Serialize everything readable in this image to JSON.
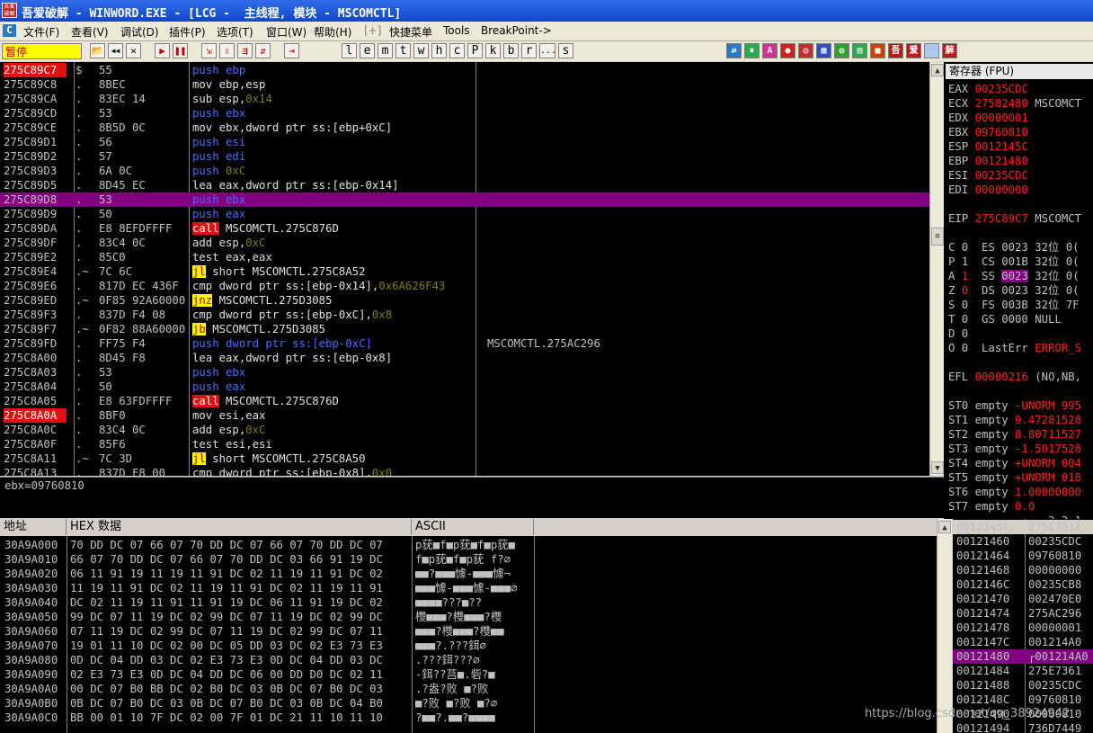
{
  "window": {
    "title": "吾爱破解 - WINWORD.EXE - [LCG -  主线程, 模块 - MSCOMCTL]",
    "icon_text": "吾爱破解"
  },
  "menu": [
    "文件(F)",
    "查看(V)",
    "调试(D)",
    "插件(P)",
    "选项(T)",
    "窗口(W)",
    "帮助(H)",
    "[+]",
    "快捷菜单",
    "Tools",
    "BreakPoint->"
  ],
  "toolbar": {
    "state": "暂停",
    "left_buttons": [
      "open-icon",
      "rewind-icon",
      "close-icon",
      "run-icon",
      "pause-icon",
      "step-into-icon",
      "step-over-icon",
      "trace-into-icon",
      "trace-over-icon",
      "execute-till-return-icon"
    ],
    "letters": [
      "l",
      "e",
      "m",
      "t",
      "w",
      "h",
      "c",
      "P",
      "k",
      "b",
      "r",
      "...",
      "s"
    ],
    "right_buttons": [
      "吾",
      "爱",
      "破",
      "解"
    ]
  },
  "disasm": {
    "selected_index": 9,
    "rows": [
      {
        "addr": "275C89C7",
        "addr_hl": true,
        "mark": "$",
        "hex": "55",
        "ins": [
          {
            "t": "push",
            "c": "blue"
          },
          {
            "t": " ebp",
            "c": "blue"
          }
        ],
        "cmt": ""
      },
      {
        "addr": "275C89C8",
        "mark": ".",
        "hex": "8BEC",
        "ins": [
          {
            "t": "mov ebp,esp",
            "c": "white"
          }
        ],
        "cmt": ""
      },
      {
        "addr": "275C89CA",
        "mark": ".",
        "hex": "83EC 14",
        "ins": [
          {
            "t": "sub esp,",
            "c": "white"
          },
          {
            "t": "0x14",
            "c": "num"
          }
        ],
        "cmt": ""
      },
      {
        "addr": "275C89CD",
        "mark": ".",
        "hex": "53",
        "ins": [
          {
            "t": "push ebx",
            "c": "blue"
          }
        ],
        "cmt": ""
      },
      {
        "addr": "275C89CE",
        "mark": ".",
        "hex": "8B5D 0C",
        "ins": [
          {
            "t": "mov ebx,dword ptr ss:[ebp+0xC]",
            "c": "white"
          }
        ],
        "cmt": ""
      },
      {
        "addr": "275C89D1",
        "mark": ".",
        "hex": "56",
        "ins": [
          {
            "t": "push esi",
            "c": "blue"
          }
        ],
        "cmt": ""
      },
      {
        "addr": "275C89D2",
        "mark": ".",
        "hex": "57",
        "ins": [
          {
            "t": "push edi",
            "c": "blue"
          }
        ],
        "cmt": ""
      },
      {
        "addr": "275C89D3",
        "mark": ".",
        "hex": "6A 0C",
        "ins": [
          {
            "t": "push ",
            "c": "blue"
          },
          {
            "t": "0xC",
            "c": "num"
          }
        ],
        "cmt": ""
      },
      {
        "addr": "275C89D5",
        "mark": ".",
        "hex": "8D45 EC",
        "ins": [
          {
            "t": "lea eax,dword ptr ss:[ebp-0x14]",
            "c": "white"
          }
        ],
        "cmt": ""
      },
      {
        "addr": "275C89D8",
        "mark": ".",
        "hex": "53",
        "ins": [
          {
            "t": "push ebx",
            "c": "blue"
          }
        ],
        "cmt": ""
      },
      {
        "addr": "275C89D9",
        "mark": ".",
        "hex": "50",
        "ins": [
          {
            "t": "push eax",
            "c": "blue"
          }
        ],
        "cmt": ""
      },
      {
        "addr": "275C89DA",
        "mark": ".",
        "hex": "E8 8EFDFFFF",
        "ins": [
          {
            "t": "call",
            "c": "hl"
          },
          {
            "t": " MSCOMCTL.275C876D",
            "c": "white"
          }
        ],
        "cmt": ""
      },
      {
        "addr": "275C89DF",
        "mark": ".",
        "hex": "83C4 0C",
        "ins": [
          {
            "t": "add esp,",
            "c": "white"
          },
          {
            "t": "0xC",
            "c": "num"
          }
        ],
        "cmt": ""
      },
      {
        "addr": "275C89E2",
        "mark": ".",
        "hex": "85C0",
        "ins": [
          {
            "t": "test eax,eax",
            "c": "white"
          }
        ],
        "cmt": ""
      },
      {
        "addr": "275C89E4",
        "mark": ".~",
        "hex": "7C 6C",
        "ins": [
          {
            "t": "jl",
            "c": "jcc"
          },
          {
            "t": " short MSCOMCTL.275C8A52",
            "c": "white"
          }
        ],
        "cmt": ""
      },
      {
        "addr": "275C89E6",
        "mark": ".",
        "hex": "817D EC 436F",
        "ins": [
          {
            "t": "cmp dword ptr ss:[ebp-0x14],",
            "c": "white"
          },
          {
            "t": "0x6A626F43",
            "c": "num"
          }
        ],
        "cmt": ""
      },
      {
        "addr": "275C89ED",
        "mark": ".~",
        "hex": "0F85 92A60000",
        "ins": [
          {
            "t": "jnz",
            "c": "jcc"
          },
          {
            "t": " MSCOMCTL.275D3085",
            "c": "white"
          }
        ],
        "cmt": ""
      },
      {
        "addr": "275C89F3",
        "mark": ".",
        "hex": "837D F4 08",
        "ins": [
          {
            "t": "cmp dword ptr ss:[ebp-0xC],",
            "c": "white"
          },
          {
            "t": "0x8",
            "c": "num"
          }
        ],
        "cmt": ""
      },
      {
        "addr": "275C89F7",
        "mark": ".~",
        "hex": "0F82 88A60000",
        "ins": [
          {
            "t": "jb",
            "c": "jcc"
          },
          {
            "t": " MSCOMCTL.275D3085",
            "c": "white"
          }
        ],
        "cmt": ""
      },
      {
        "addr": "275C89FD",
        "mark": ".",
        "hex": "FF75 F4",
        "ins": [
          {
            "t": "push dword ptr ss:[ebp-0xC]",
            "c": "blue"
          }
        ],
        "cmt": "MSCOMCTL.275AC296"
      },
      {
        "addr": "275C8A00",
        "mark": ".",
        "hex": "8D45 F8",
        "ins": [
          {
            "t": "lea eax,dword ptr ss:[ebp-0x8]",
            "c": "white"
          }
        ],
        "cmt": ""
      },
      {
        "addr": "275C8A03",
        "mark": ".",
        "hex": "53",
        "ins": [
          {
            "t": "push ebx",
            "c": "blue"
          }
        ],
        "cmt": ""
      },
      {
        "addr": "275C8A04",
        "mark": ".",
        "hex": "50",
        "ins": [
          {
            "t": "push eax",
            "c": "blue"
          }
        ],
        "cmt": ""
      },
      {
        "addr": "275C8A05",
        "mark": ".",
        "hex": "E8 63FDFFFF",
        "ins": [
          {
            "t": "call",
            "c": "hl"
          },
          {
            "t": " MSCOMCTL.275C876D",
            "c": "white"
          }
        ],
        "cmt": ""
      },
      {
        "addr": "275C8A0A",
        "addr_hl": true,
        "mark": ".",
        "hex": "8BF0",
        "ins": [
          {
            "t": "mov esi,eax",
            "c": "white"
          }
        ],
        "cmt": ""
      },
      {
        "addr": "275C8A0C",
        "mark": ".",
        "hex": "83C4 0C",
        "ins": [
          {
            "t": "add esp,",
            "c": "white"
          },
          {
            "t": "0xC",
            "c": "num"
          }
        ],
        "cmt": ""
      },
      {
        "addr": "275C8A0F",
        "mark": ".",
        "hex": "85F6",
        "ins": [
          {
            "t": "test esi,esi",
            "c": "white"
          }
        ],
        "cmt": ""
      },
      {
        "addr": "275C8A11",
        "mark": ".~",
        "hex": "7C 3D",
        "ins": [
          {
            "t": "jl",
            "c": "jcc"
          },
          {
            "t": " short MSCOMCTL.275C8A50",
            "c": "white"
          }
        ],
        "cmt": ""
      },
      {
        "addr": "275C8A13",
        "mark": ".",
        "hex": "837D F8 00",
        "ins": [
          {
            "t": "cmp dword ptr ss:[ebp-0x8],",
            "c": "white"
          },
          {
            "t": "0x0",
            "c": "num"
          }
        ],
        "cmt": ""
      }
    ]
  },
  "info": "ebx=09760810",
  "registers": {
    "header": "寄存器 (FPU)",
    "rows": [
      [
        {
          "t": "EAX "
        },
        {
          "t": "00235CDC",
          "c": "red"
        }
      ],
      [
        {
          "t": "ECX "
        },
        {
          "t": "27582480",
          "c": "red"
        },
        {
          "t": " MSCOMCT"
        }
      ],
      [
        {
          "t": "EDX "
        },
        {
          "t": "00000001",
          "c": "red"
        }
      ],
      [
        {
          "t": "EBX "
        },
        {
          "t": "09760810",
          "c": "red"
        }
      ],
      [
        {
          "t": "ESP "
        },
        {
          "t": "0012145C",
          "c": "red"
        }
      ],
      [
        {
          "t": "EBP "
        },
        {
          "t": "00121480",
          "c": "red"
        }
      ],
      [
        {
          "t": "ESI "
        },
        {
          "t": "00235CDC",
          "c": "red"
        }
      ],
      [
        {
          "t": "EDI "
        },
        {
          "t": "00000000",
          "c": "red"
        }
      ],
      [
        {
          "t": ""
        }
      ],
      [
        {
          "t": "EIP "
        },
        {
          "t": "275C89C7",
          "c": "red"
        },
        {
          "t": " MSCOMCT"
        }
      ],
      [
        {
          "t": ""
        }
      ],
      [
        {
          "t": "C 0  ES 0023 32位 0("
        }
      ],
      [
        {
          "t": "P 1  CS 001B 32位 0("
        }
      ],
      [
        {
          "t": "A "
        },
        {
          "t": "1",
          "c": "red"
        },
        {
          "t": "  SS "
        },
        {
          "t": "0023",
          "c": "mag"
        },
        {
          "t": " 32位 0("
        }
      ],
      [
        {
          "t": "Z "
        },
        {
          "t": "0",
          "c": "red"
        },
        {
          "t": "  DS 0023 32位 0("
        }
      ],
      [
        {
          "t": "S 0  FS 003B 32位 7F"
        }
      ],
      [
        {
          "t": "T 0  GS 0000 NULL"
        }
      ],
      [
        {
          "t": "D 0"
        }
      ],
      [
        {
          "t": "O 0  LastErr "
        },
        {
          "t": "ERROR_S",
          "c": "red"
        }
      ],
      [
        {
          "t": ""
        }
      ],
      [
        {
          "t": "EFL "
        },
        {
          "t": "00000216",
          "c": "red"
        },
        {
          "t": " (NO,NB,"
        }
      ],
      [
        {
          "t": ""
        }
      ],
      [
        {
          "t": "ST0 empty "
        },
        {
          "t": "-UNORM 995",
          "c": "red"
        }
      ],
      [
        {
          "t": "ST1 empty "
        },
        {
          "t": "9.47281528",
          "c": "red"
        }
      ],
      [
        {
          "t": "ST2 empty "
        },
        {
          "t": "8.80711527",
          "c": "red"
        }
      ],
      [
        {
          "t": "ST3 empty "
        },
        {
          "t": "-1.5017528",
          "c": "red"
        }
      ],
      [
        {
          "t": "ST4 empty "
        },
        {
          "t": "+UNORM 004",
          "c": "red"
        }
      ],
      [
        {
          "t": "ST5 empty "
        },
        {
          "t": "+UNORM 018",
          "c": "red"
        }
      ],
      [
        {
          "t": "ST6 empty "
        },
        {
          "t": "1.00000000",
          "c": "red"
        }
      ],
      [
        {
          "t": "ST7 empty "
        },
        {
          "t": "0.0",
          "c": "red"
        }
      ],
      [
        {
          "t": "               3 2 1"
        }
      ],
      [
        {
          "t": "FST "
        },
        {
          "t": "4000",
          "c": "red"
        },
        {
          "t": "  Cond "
        },
        {
          "t": "1",
          "c": "red"
        },
        {
          "t": " 0 0"
        }
      ]
    ]
  },
  "dump": {
    "headers": [
      "地址",
      "HEX 数据",
      "ASCII"
    ],
    "rows": [
      {
        "a": "30A9A000",
        "h": "70 DD DC 07 66 07 70 DD DC 07 66 07 70 DD DC 07",
        "s": "p莸■f■p莸■f■p莸■"
      },
      {
        "a": "30A9A010",
        "h": "66 07 70 DD DC 07 66 07 70 DD DC 03 66 91 19 DC",
        "s": "f■p莸■f■p莸 f?∅"
      },
      {
        "a": "30A9A020",
        "h": "06 11 91 19 11 19 11 91 DC 02 11 19 11 91 DC 02",
        "s": "■■?■■■懅-■■■懅¬"
      },
      {
        "a": "30A9A030",
        "h": "11 19 11 91 DC 02 11 19 11 91 DC 02 11 19 11 91",
        "s": "■■■懅-■■■懅-■■■∅"
      },
      {
        "a": "30A9A040",
        "h": "DC 02 11 19 11 91 11 91 19 DC 06 11 91 19 DC 02",
        "s": "■■■■???■??"
      },
      {
        "a": "30A9A050",
        "h": "99 DC 07 11 19 DC 02 99 DC 07 11 19 DC 02 99 DC",
        "s": "欆■■■?欆■■■?欆"
      },
      {
        "a": "30A9A060",
        "h": "07 11 19 DC 02 99 DC 07 11 19 DC 02 99 DC 07 11",
        "s": "■■■?欆■■■?欆■■"
      },
      {
        "a": "30A9A070",
        "h": "19 01 11 10 DC 02 00 DC 05 DD 03 DC 02 E3 73 E3",
        "s": "■■■?.???鉺∅"
      },
      {
        "a": "30A9A080",
        "h": "0D DC 04 DD 03 DC 02 E3 73 E3 0D DC 04 DD 03 DC",
        "s": ".???鉺???∅"
      },
      {
        "a": "30A9A090",
        "h": "02 E3 73 E3 0D DC 04 DD DC 06 00 DD D0 DC 02 11",
        "s": "-鉺??莒■.砦?■"
      },
      {
        "a": "30A9A0A0",
        "h": "00 DC 07 B0 BB DC 02 B0 DC 03 0B DC 07 B0 DC 03",
        "s": ".?盎?败 ■?败"
      },
      {
        "a": "30A9A0B0",
        "h": "0B DC 07 B0 DC 03 0B DC 07 B0 DC 03 0B DC 04 B0",
        "s": "■?败 ■?败 ■?∅"
      },
      {
        "a": "30A9A0C0",
        "h": "BB 00 01 10 7F DC 02 00 7F 01 DC 21 11 10 11 10",
        "s": "?■■?.■■?■■■■"
      }
    ]
  },
  "stack": {
    "selected_index": 9,
    "rows": [
      {
        "a": "0012145C",
        "v": "275E701A",
        "hdr": true
      },
      {
        "a": "00121460",
        "v": "00235CDC"
      },
      {
        "a": "00121464",
        "v": "09760810"
      },
      {
        "a": "00121468",
        "v": "00000000"
      },
      {
        "a": "0012146C",
        "v": "00235CB8"
      },
      {
        "a": "00121470",
        "v": "002470E0"
      },
      {
        "a": "00121474",
        "v": "275AC296"
      },
      {
        "a": "00121478",
        "v": "00000001"
      },
      {
        "a": "0012147C",
        "v": "001214A0"
      },
      {
        "a": "00121480",
        "v": "┌001214A0"
      },
      {
        "a": "00121484",
        "v": "275E7361"
      },
      {
        "a": "00121488",
        "v": "00235CDC"
      },
      {
        "a": "0012148C",
        "v": "09760810"
      },
      {
        "a": "00121490",
        "v": "00000810"
      },
      {
        "a": "00121494",
        "v": "736D7449"
      }
    ]
  },
  "watermark": "https://blog.csdn.net/qq_38924942"
}
